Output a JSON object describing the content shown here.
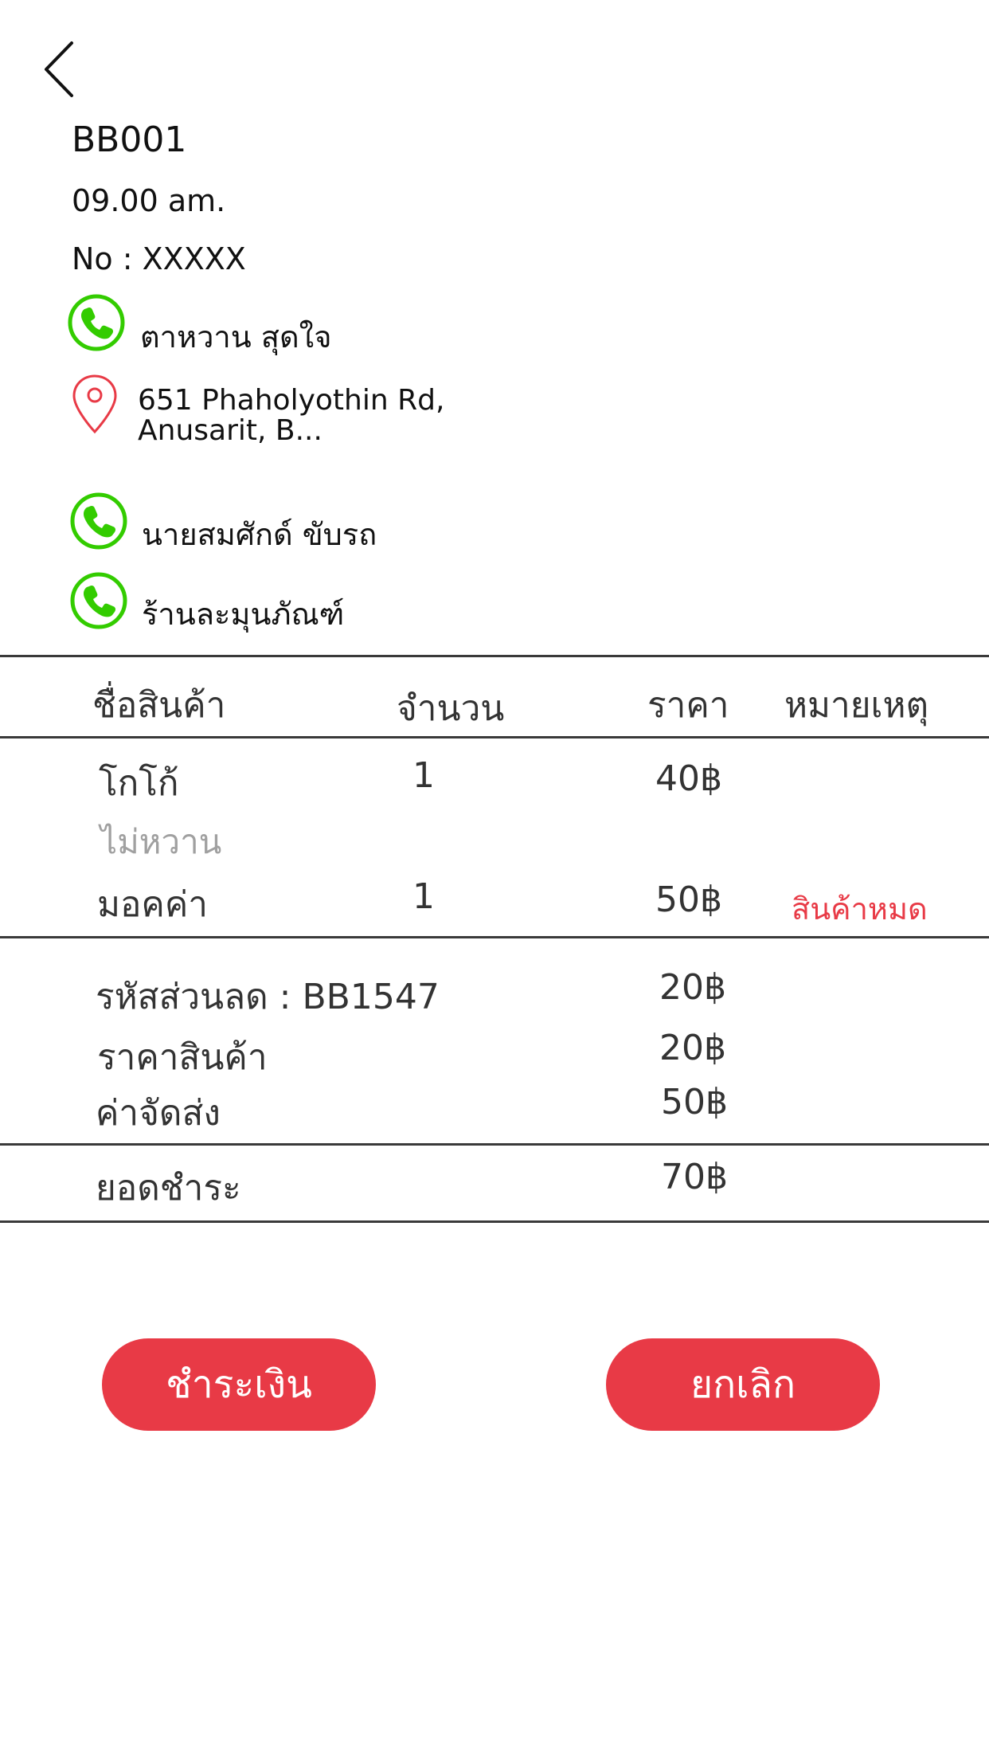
{
  "order": {
    "code": "BB001",
    "time": "09.00 am.",
    "number": "No : XXXXX"
  },
  "contacts": {
    "customer_name": "ตาหวาน สุดใจ",
    "address_line1": "651 Phaholyothin Rd,",
    "address_line2": "Anusarit, B...",
    "driver_name": "นายสมศักด์ ขับรถ",
    "shop_name": "ร้านละมุนภัณฑ์"
  },
  "table": {
    "headers": [
      "ชื่อสินค้า",
      "จำนวน",
      "ราคา",
      "หมายเหตุ"
    ],
    "rows": [
      {
        "name": "โกโก้",
        "qty": "1",
        "price": "40฿",
        "note": ""
      },
      {
        "name": "มอคค่า",
        "qty": "1",
        "price": "50฿",
        "note": "สินค้าหมด"
      }
    ],
    "sub_note": "ไม่หวาน"
  },
  "summary": {
    "discount_label": "รหัสส่วนลด : BB1547",
    "discount_value": "20฿",
    "goods_label": "ราคาสินค้า",
    "goods_value": "20฿",
    "shipping_label": "ค่าจัดส่ง",
    "shipping_value": "50฿",
    "total_label": "ยอดชำระ",
    "total_value": "70฿"
  },
  "buttons": {
    "pay": "ชำระเงิน",
    "cancel": "ยกเลิก"
  },
  "icons": {
    "back": "chevron-left-icon",
    "phone": "phone-icon",
    "location": "map-pin-icon"
  },
  "colors": {
    "phone_green": "#33cc00",
    "accent_red": "#e83a46",
    "out_of_stock": "#e83a46"
  }
}
